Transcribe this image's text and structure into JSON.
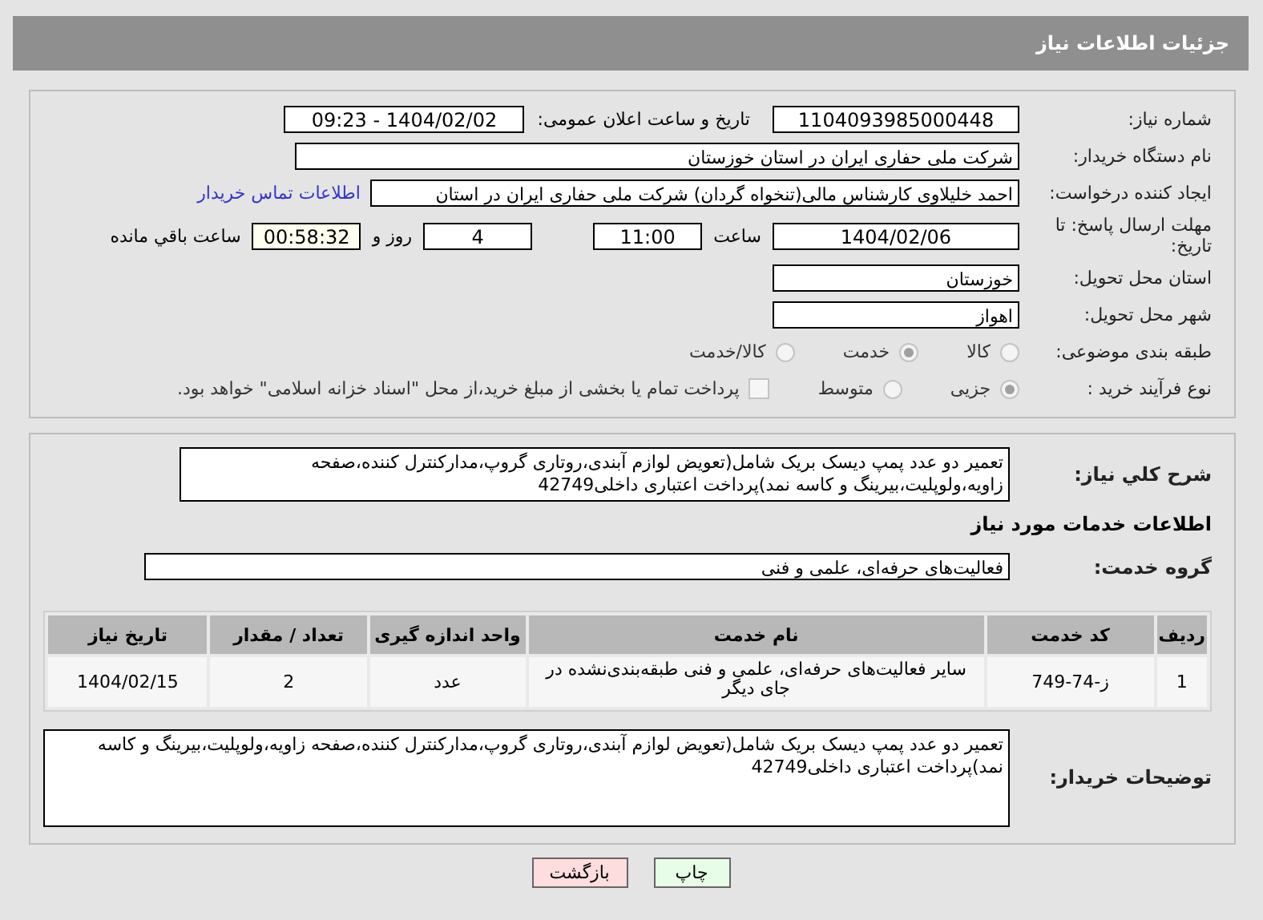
{
  "header": {
    "title": "جزئیات اطلاعات نیاز"
  },
  "need_number": {
    "label": "شماره نیاز:",
    "value": "1104093985000448"
  },
  "announce": {
    "label": "تاریخ و ساعت اعلان عمومی:",
    "value": "1404/02/02 - 09:23"
  },
  "buyer_org": {
    "label": "نام دستگاه خریدار:",
    "value": "شرکت ملی حفاری ایران در استان خوزستان"
  },
  "requester": {
    "label": "ایجاد کننده درخواست:",
    "value": "احمد خلیلاوی کارشناس مالی(تنخواه گردان) شرکت ملی حفاری ایران در استان",
    "link": "اطلاعات تماس خریدار"
  },
  "deadline": {
    "label": "مهلت ارسال پاسخ: تا تاریخ:",
    "date": "1404/02/06",
    "time_label": "ساعت",
    "time": "11:00",
    "days": "4",
    "days_label": "روز و",
    "remaining": "00:58:32",
    "remaining_label": "ساعت باقي مانده"
  },
  "province": {
    "label": "استان محل تحویل:",
    "value": "خوزستان"
  },
  "city": {
    "label": "شهر محل تحویل:",
    "value": "اهواز"
  },
  "category": {
    "label": "طبقه بندی موضوعی:",
    "options": [
      {
        "label": "کالا",
        "selected": false
      },
      {
        "label": "خدمت",
        "selected": true
      },
      {
        "label": "کالا/خدمت",
        "selected": false
      }
    ]
  },
  "process": {
    "label": "نوع فرآیند خرید :",
    "options": [
      {
        "label": "جزیی",
        "selected": true
      },
      {
        "label": "متوسط",
        "selected": false
      }
    ],
    "treasury": {
      "checked": false,
      "label": "پرداخت تمام یا بخشی از مبلغ خرید،از محل \"اسناد خزانه اسلامی\" خواهد بود."
    }
  },
  "summary": {
    "label": "شرح کلي نياز:",
    "value": "تعمیر دو عدد پمپ دیسک بریک شامل(تعویض لوازم آبندی،روتاری گروپ،مدارکنترل کننده،صفحه زاویه،ولوپلیت،بیرینگ و کاسه نمد)پرداخت اعتباری داخلی42749"
  },
  "services_heading": "اطلاعات خدمات مورد نياز",
  "service_group": {
    "label": "گروه خدمت:",
    "value": "فعالیت‌های حرفه‌ای، علمی و فنی"
  },
  "table": {
    "columns": [
      "رديف",
      "کد خدمت",
      "نام خدمت",
      "واحد اندازه گیری",
      "تعداد / مقدار",
      "تاریخ نیاز"
    ],
    "rows": [
      [
        "1",
        "ز-74-749",
        "سایر فعالیت‌های حرفه‌ای، علمی و فنی طبقه‌بندی‌نشده در جای دیگر",
        "عدد",
        "2",
        "1404/02/15"
      ]
    ]
  },
  "buyer_notes": {
    "label": "توضیحات خریدار:",
    "value": "تعمیر دو عدد پمپ دیسک بریک شامل(تعویض لوازم آبندی،روتاری گروپ،مدارکنترل کننده،صفحه زاویه،ولوپلیت،بیرینگ و کاسه نمد)پرداخت اعتباری داخلی42749"
  },
  "buttons": [
    {
      "kind": "print",
      "label": "چاپ"
    },
    {
      "kind": "back",
      "label": "بازگشت"
    }
  ]
}
